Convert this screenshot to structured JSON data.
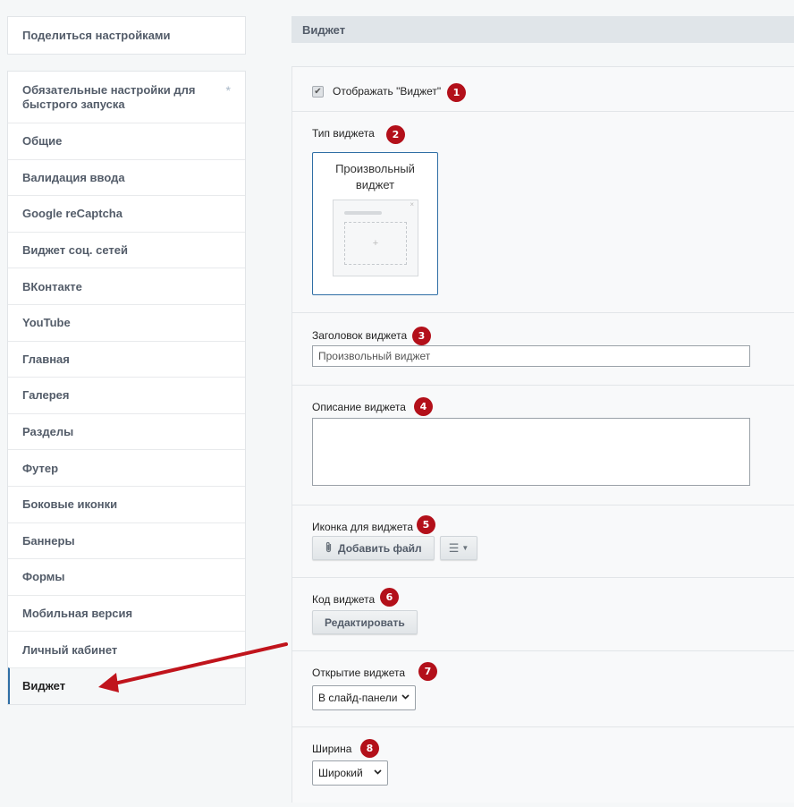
{
  "sidebar": {
    "share_label": "Поделиться настройками",
    "items": [
      {
        "label": "Обязательные настройки для быстрого запуска",
        "marker": "*"
      },
      {
        "label": "Общие"
      },
      {
        "label": "Валидация ввода"
      },
      {
        "label": "Google reCaptcha"
      },
      {
        "label": "Виджет соц. сетей"
      },
      {
        "label": "ВКонтакте"
      },
      {
        "label": "YouTube"
      },
      {
        "label": "Главная"
      },
      {
        "label": "Галерея"
      },
      {
        "label": "Разделы"
      },
      {
        "label": "Футер"
      },
      {
        "label": "Боковые иконки"
      },
      {
        "label": "Баннеры"
      },
      {
        "label": "Формы"
      },
      {
        "label": "Мобильная версия"
      },
      {
        "label": "Личный кабинет"
      },
      {
        "label": "Виджет",
        "active": true
      }
    ]
  },
  "main": {
    "section_title": "Виджет",
    "show_widget": {
      "label": "Отображать \"Виджет\"",
      "checked": true,
      "badge": "1"
    },
    "widget_type": {
      "label": "Тип виджета",
      "badge": "2",
      "card_title": "Произвольный виджет",
      "card_plus": "+",
      "card_close": "×"
    },
    "widget_title": {
      "label": "Заголовок виджета",
      "badge": "3",
      "value": "Произвольный виджет"
    },
    "widget_description": {
      "label": "Описание виджета",
      "badge": "4",
      "value": ""
    },
    "widget_icon": {
      "label": "Иконка для виджета",
      "badge": "5",
      "add_file_label": "Добавить файл"
    },
    "widget_code": {
      "label": "Код виджета",
      "badge": "6",
      "edit_label": "Редактировать"
    },
    "widget_opening": {
      "label": "Открытие виджета",
      "badge": "7",
      "selected": "В слайд-панели"
    },
    "width": {
      "label": "Ширина",
      "badge": "8",
      "selected": "Широкий"
    }
  },
  "colors": {
    "badge": "#b3101a",
    "active_border": "#2f6ea5",
    "arrow": "#c0141c"
  },
  "icons": {
    "checkbox": "checkmark-icon",
    "clip": "paperclip-icon",
    "menu": "hamburger-icon",
    "select": "chevron-down-icon"
  }
}
